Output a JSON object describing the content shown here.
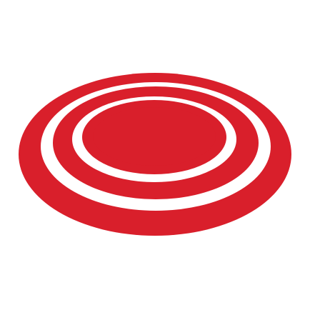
{
  "image": {
    "background_color": "#ffffff",
    "icon": "target-rings-icon",
    "ring_color": "#d91f2b",
    "gap_color": "#ffffff"
  }
}
